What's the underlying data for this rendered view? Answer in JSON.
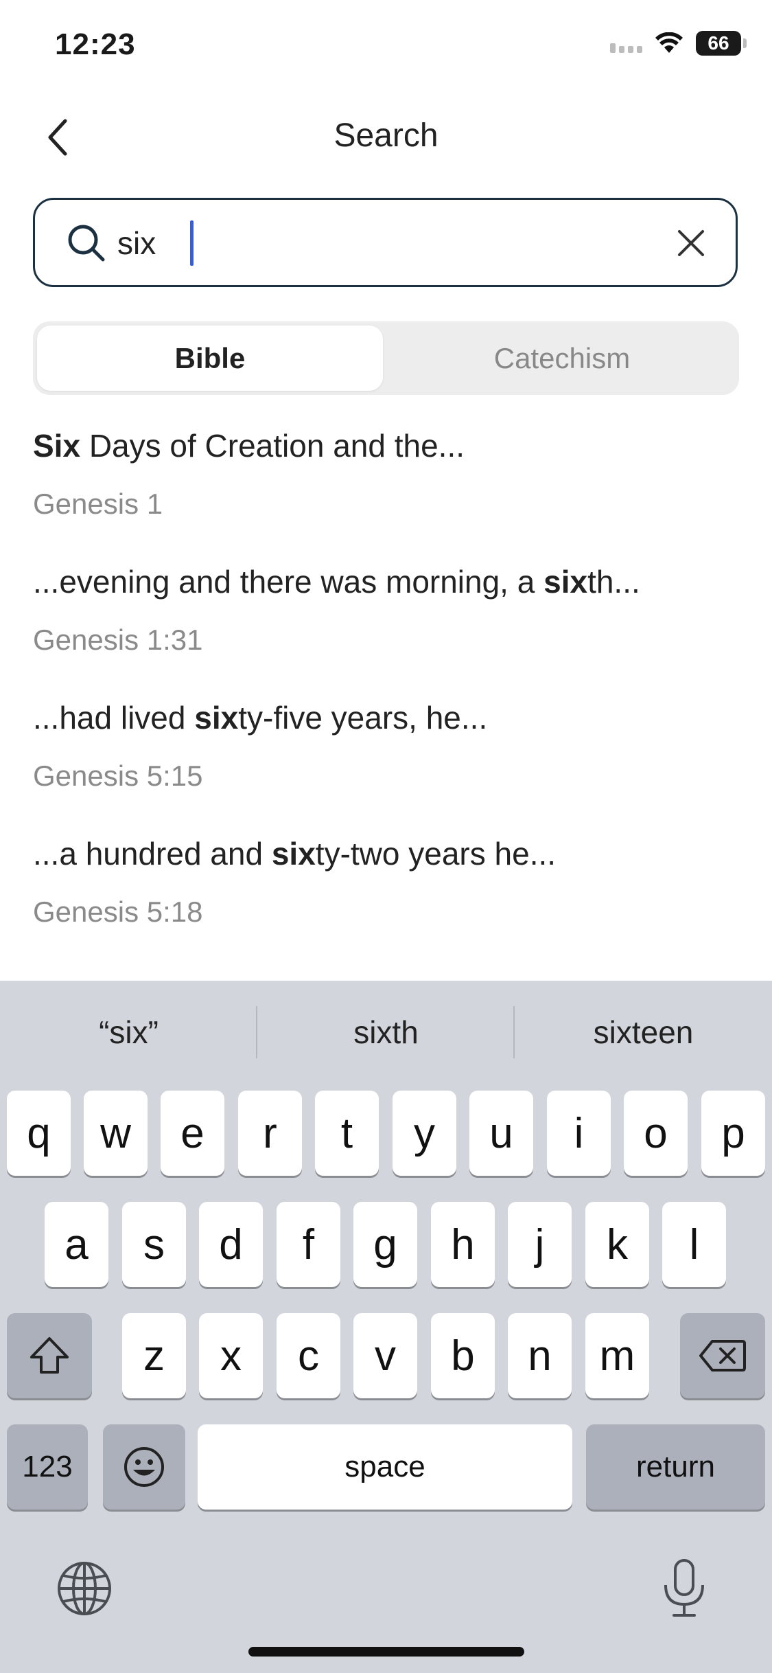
{
  "status_bar": {
    "time": "12:23",
    "battery": "66"
  },
  "header": {
    "title": "Search"
  },
  "search": {
    "value": "six",
    "placeholder": ""
  },
  "tabs": [
    {
      "label": "Bible",
      "active": true
    },
    {
      "label": "Catechism",
      "active": false
    }
  ],
  "results": [
    {
      "before": "",
      "match": "Six",
      "after": " Days of Creation and the...",
      "ref": "Genesis 1"
    },
    {
      "before": "...evening and there was morning, a ",
      "match": "six",
      "after": "th...",
      "ref": "Genesis 1:31"
    },
    {
      "before": "...had lived ",
      "match": "six",
      "after": "ty-five years, he...",
      "ref": "Genesis 5:15"
    },
    {
      "before": "...a hundred and ",
      "match": "six",
      "after": "ty-two years he...",
      "ref": "Genesis 5:18"
    }
  ],
  "keyboard": {
    "suggestions": [
      "“six”",
      "sixth",
      "sixteen"
    ],
    "row1": [
      "q",
      "w",
      "e",
      "r",
      "t",
      "y",
      "u",
      "i",
      "o",
      "p"
    ],
    "row2": [
      "a",
      "s",
      "d",
      "f",
      "g",
      "h",
      "j",
      "k",
      "l"
    ],
    "row3": [
      "z",
      "x",
      "c",
      "v",
      "b",
      "n",
      "m"
    ],
    "numbers_label": "123",
    "space_label": "space",
    "return_label": "return"
  },
  "colors": {
    "accent": "#1b3142",
    "caret": "#2f5ee8",
    "keyboard_bg": "#d2d5db"
  }
}
